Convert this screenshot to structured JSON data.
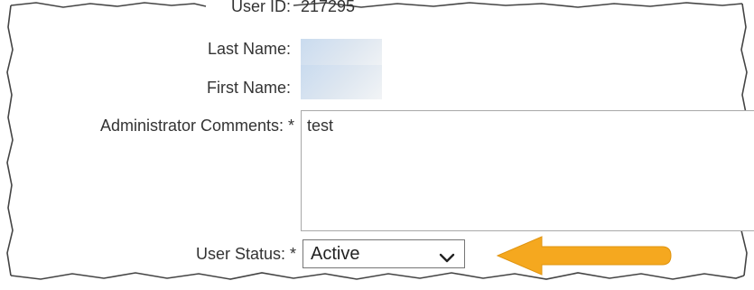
{
  "form": {
    "user_id_label": "User ID:",
    "user_id_value": "217295",
    "last_name_label": "Last Name:",
    "first_name_label": "First Name:",
    "comments_label": "Administrator Comments: *",
    "comments_value": "test",
    "status_label": "User Status: *",
    "status_value": "Active"
  },
  "icons": {
    "status_dropdown": "chevron-down-icon",
    "callout": "arrow-left-icon"
  },
  "colors": {
    "callout_arrow": "#f5a81f",
    "text": "#333333",
    "border": "#a9a9a9"
  }
}
